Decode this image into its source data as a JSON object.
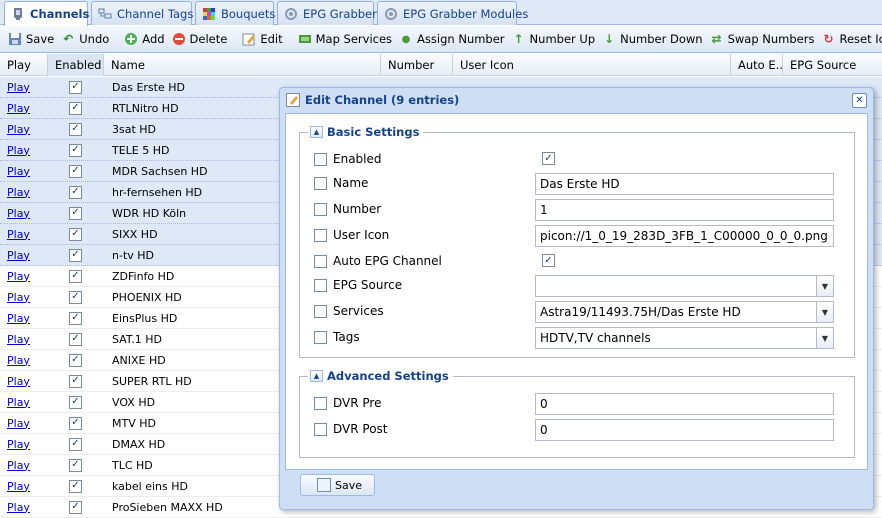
{
  "tabs": [
    {
      "label": "Channels",
      "icon": "tv-icon",
      "active": true
    },
    {
      "label": "Channel Tags",
      "icon": "tags-icon",
      "active": false
    },
    {
      "label": "Bouquets",
      "icon": "bouquet-icon",
      "active": false
    },
    {
      "label": "EPG Grabber",
      "icon": "epg-icon",
      "active": false
    },
    {
      "label": "EPG Grabber Modules",
      "icon": "epg-modules-icon",
      "active": false
    }
  ],
  "toolbar": {
    "save": "Save",
    "undo": "Undo",
    "add": "Add",
    "delete": "Delete",
    "edit": "Edit",
    "map_services": "Map Services",
    "assign_number": "Assign Number",
    "number_up": "Number Up",
    "number_down": "Number Down",
    "swap_numbers": "Swap Numbers",
    "reset_icon": "Reset Icon"
  },
  "grid": {
    "columns": {
      "play": "Play",
      "enabled": "Enabled",
      "name": "Name",
      "number": "Number",
      "user_icon": "User Icon",
      "auto_epg": "Auto E...",
      "epg_source": "EPG Source"
    },
    "play_label": "Play",
    "rows": [
      {
        "name": "Das Erste HD",
        "selected": true
      },
      {
        "name": "RTLNitro HD",
        "selected": true
      },
      {
        "name": "3sat HD",
        "selected": true
      },
      {
        "name": "TELE 5 HD",
        "selected": true
      },
      {
        "name": "MDR Sachsen HD",
        "selected": true
      },
      {
        "name": "hr-fernsehen HD",
        "selected": true
      },
      {
        "name": "WDR HD Köln",
        "selected": true
      },
      {
        "name": "SIXX HD",
        "selected": true
      },
      {
        "name": "n-tv HD",
        "selected": true
      },
      {
        "name": "ZDFinfo HD",
        "selected": false
      },
      {
        "name": "PHOENIX HD",
        "selected": false
      },
      {
        "name": "EinsPlus HD",
        "selected": false
      },
      {
        "name": "SAT.1 HD",
        "selected": false
      },
      {
        "name": "ANIXE HD",
        "selected": false
      },
      {
        "name": "SUPER RTL HD",
        "selected": false
      },
      {
        "name": "VOX HD",
        "selected": false
      },
      {
        "name": "MTV HD",
        "selected": false
      },
      {
        "name": "DMAX HD",
        "selected": false
      },
      {
        "name": "TLC HD",
        "selected": false
      },
      {
        "name": "kabel eins HD",
        "selected": false
      },
      {
        "name": "ProSieben MAXX HD",
        "selected": false
      }
    ]
  },
  "dialog": {
    "title": "Edit Channel (9 entries)",
    "basic_legend": "Basic Settings",
    "advanced_legend": "Advanced Settings",
    "fields": {
      "enabled_label": "Enabled",
      "name_label": "Name",
      "name_value": "Das Erste HD",
      "number_label": "Number",
      "number_value": "1",
      "user_icon_label": "User Icon",
      "user_icon_value": "picon://1_0_19_283D_3FB_1_C00000_0_0_0.png",
      "auto_epg_label": "Auto EPG Channel",
      "epg_source_label": "EPG Source",
      "epg_source_value": "",
      "services_label": "Services",
      "services_value": "Astra19/11493.75H/Das Erste HD",
      "tags_label": "Tags",
      "tags_value": "HDTV,TV channels",
      "dvr_pre_label": "DVR Pre",
      "dvr_pre_value": "0",
      "dvr_post_label": "DVR Post",
      "dvr_post_value": "0"
    },
    "save_label": "Save"
  },
  "colors": {
    "accent": "#15428b",
    "border": "#99bbe8",
    "selected_row": "#dfe8f6"
  }
}
